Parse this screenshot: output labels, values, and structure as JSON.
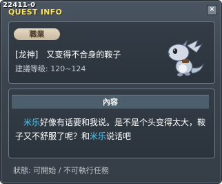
{
  "window": {
    "quest_id": "22411-0",
    "title": "QUEST INFO",
    "close_label": "×"
  },
  "summary": {
    "job_badge": "職業",
    "quest_name": "[龙神]　又变得不合身的鞍子",
    "recommended_level": "建議等级: 120~124",
    "icon": "dragon-mir-icon"
  },
  "content": {
    "header": "內容",
    "npc_name": "米乐",
    "text_part1": "好像有话要和我说。是不是个头变得太大，鞍子又不舒服了呢？和",
    "text_part2": "说话吧"
  },
  "status": {
    "text": "狀態: 可開始 / 不可執行任務"
  },
  "colors": {
    "title": "#f7e36a",
    "npc": "#56c5f0",
    "panel_bg": "#2f3740"
  }
}
